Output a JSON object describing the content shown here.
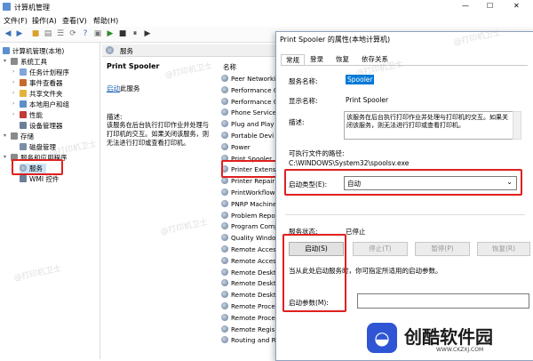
{
  "window": {
    "title": "计算机管理",
    "controls": [
      "—",
      "☐",
      "✕"
    ]
  },
  "menu": [
    "文件(F)",
    "操作(A)",
    "查看(V)",
    "帮助(H)"
  ],
  "tree": {
    "items": [
      {
        "label": "计算机管理(本地)",
        "level": 0
      },
      {
        "label": "系统工具",
        "level": 1
      },
      {
        "label": "任务计划程序",
        "level": 2
      },
      {
        "label": "事件查看器",
        "level": 2
      },
      {
        "label": "共享文件夹",
        "level": 2
      },
      {
        "label": "本地用户和组",
        "level": 2
      },
      {
        "label": "性能",
        "level": 2
      },
      {
        "label": "设备管理器",
        "level": 2
      },
      {
        "label": "存储",
        "level": 1
      },
      {
        "label": "磁盘管理",
        "level": 2
      },
      {
        "label": "服务和应用程序",
        "level": 1
      },
      {
        "label": "服务",
        "level": 2
      },
      {
        "label": "WMI 控件",
        "level": 2
      }
    ]
  },
  "middle": {
    "header": "服务",
    "service_name": "Print Spooler",
    "start_link": "启动",
    "start_suffix": "此服务",
    "desc_label": "描述:",
    "desc_text": "该服务在后台执行打印作业并处理与打印机的交互。如果关闭该服务，则无法进行打印或查看打印机。",
    "column_name": "名称",
    "services": [
      "Peer Networking",
      "Performance C",
      "Performance C",
      "Phone Service",
      "Plug and Play",
      "Portable Devi",
      "Power",
      "Print Spooler",
      "Printer Extensi",
      "Printer Repair",
      "PrintWorkflow",
      "PNRP Machine",
      "Problem Repor",
      "Program Comp",
      "Quality Windo",
      "Remote Access",
      "Remote Access",
      "Remote Deskt",
      "Remote Deskt",
      "Remote Deskt",
      "Remote Proce",
      "Remote Proce",
      "Remote Regis",
      "Routing and R"
    ]
  },
  "dialog": {
    "title": "Print Spooler 的属性(本地计算机)",
    "tabs": [
      "常规",
      "登录",
      "恢复",
      "依存关系"
    ],
    "service_name_label": "服务名称:",
    "service_name_value": "Spooler",
    "display_name_label": "显示名称:",
    "display_name_value": "Print Spooler",
    "desc_label": "描述:",
    "desc_value": "该服务在后台执行打印作业并处理与打印机的交互。如果关闭该服务，则无法进行打印或查看打印机。",
    "exe_label": "可执行文件的路径:",
    "exe_value": "C:\\WINDOWS\\System32\\spoolsv.exe",
    "startup_type_label": "启动类型(E):",
    "startup_type_value": "自动",
    "status_label": "服务状态:",
    "status_value": "已停止",
    "buttons": {
      "start": "启动(S)",
      "stop": "停止(T)",
      "pause": "暂停(P)",
      "resume": "恢复(R)"
    },
    "hint": "当从此处启动服务时，你可指定所适用的启动参数。",
    "params_label": "启动参数(M):",
    "params_value": ""
  },
  "watermark": {
    "text": "@打印机卫士",
    "brand": "创酷软件园",
    "brand_url": "WWW.CKZXJ.COM"
  },
  "colors": {
    "highlight": "#e0201e",
    "selection": "#0078d7",
    "accent": "#3d6fb6"
  }
}
